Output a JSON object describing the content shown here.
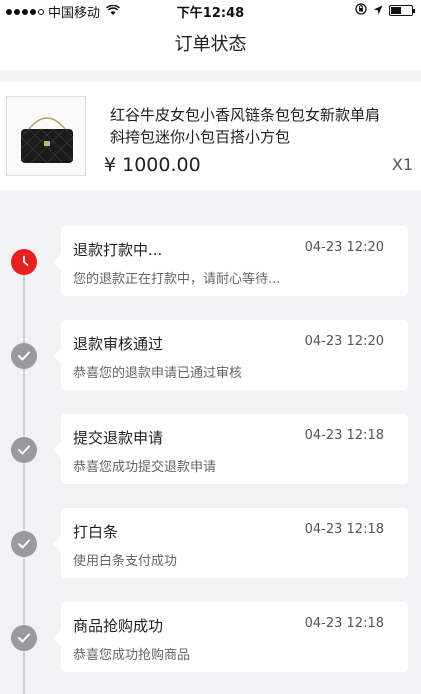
{
  "status_bar": {
    "carrier": "中国移动",
    "time": "下午12:48"
  },
  "nav": {
    "title": "订单状态"
  },
  "product": {
    "title_line1": "红谷牛皮女包小香风链条包包女新款单肩",
    "title_line2": "斜挎包迷你小包百搭小方包",
    "price": "¥ 1000.00",
    "quantity": "X1"
  },
  "timeline": [
    {
      "title": "退款打款中...",
      "time": "04-23 12:20",
      "desc": "您的退款正在打款中，请耐心等待...",
      "status": "active"
    },
    {
      "title": "退款审核通过",
      "time": "04-23 12:20",
      "desc": "恭喜您的退款申请已通过审核",
      "status": "done"
    },
    {
      "title": "提交退款申请",
      "time": "04-23 12:18",
      "desc": "恭喜您成功提交退款申请",
      "status": "done"
    },
    {
      "title": "打白条",
      "time": "04-23 12:18",
      "desc": "使用白条支付成功",
      "status": "done"
    },
    {
      "title": "商品抢购成功",
      "time": "04-23 12:18",
      "desc": "恭喜您成功抢购商品",
      "status": "done"
    }
  ],
  "colors": {
    "active": "#e42020",
    "done": "#9a9a9e"
  }
}
